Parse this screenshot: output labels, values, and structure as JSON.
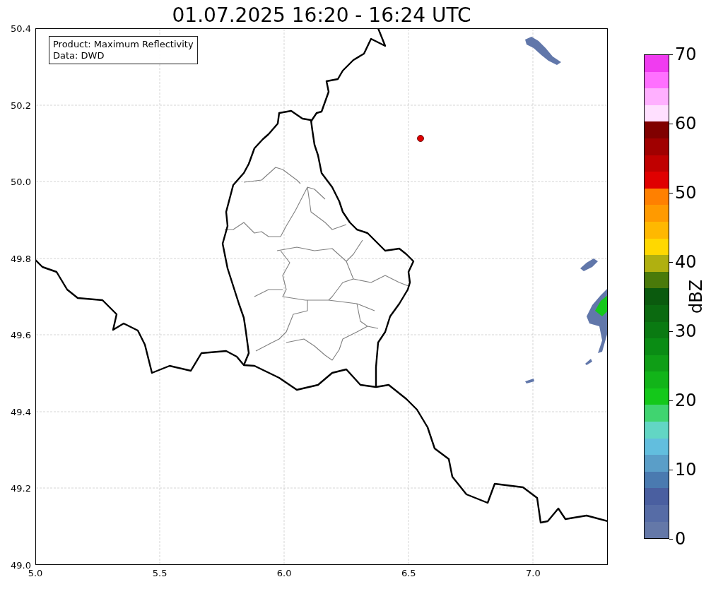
{
  "title": "01.07.2025 16:20 - 16:24 UTC",
  "legend": {
    "lines": [
      "Product: Maximum Reflectivity",
      "Data: DWD"
    ]
  },
  "map": {
    "x_ticks": [
      "5.0",
      "5.5",
      "6.0",
      "6.5",
      "7.0"
    ],
    "y_ticks": [
      "50.4",
      "50.2",
      "50.0",
      "49.8",
      "49.6",
      "49.4",
      "49.2",
      "49.0"
    ]
  },
  "colorbar": {
    "label": "dBZ",
    "ticks": [
      "70",
      "60",
      "50",
      "40",
      "30",
      "20",
      "10",
      "0"
    ],
    "bins": [
      {
        "color": "#f03cf0"
      },
      {
        "color": "#ff70ff"
      },
      {
        "color": "#ffb0ff"
      },
      {
        "color": "#ffe0ff"
      },
      {
        "color": "#800000"
      },
      {
        "color": "#a00000"
      },
      {
        "color": "#c00000"
      },
      {
        "color": "#e00000"
      },
      {
        "color": "#ff8000"
      },
      {
        "color": "#ff9a00"
      },
      {
        "color": "#ffb800"
      },
      {
        "color": "#ffd800"
      },
      {
        "color": "#b0b010"
      },
      {
        "color": "#4a7a0a"
      },
      {
        "color": "#0b5a0e"
      },
      {
        "color": "#0b6a10"
      },
      {
        "color": "#0a7a12"
      },
      {
        "color": "#0a8c14"
      },
      {
        "color": "#0f9e16"
      },
      {
        "color": "#12b419"
      },
      {
        "color": "#14c81a"
      },
      {
        "color": "#40d470"
      },
      {
        "color": "#62d6c4"
      },
      {
        "color": "#62bede"
      },
      {
        "color": "#5a9ec8"
      },
      {
        "color": "#4a7ab0"
      },
      {
        "color": "#4a5fa0"
      },
      {
        "color": "#566ca6"
      },
      {
        "color": "#6478a8"
      }
    ]
  }
}
